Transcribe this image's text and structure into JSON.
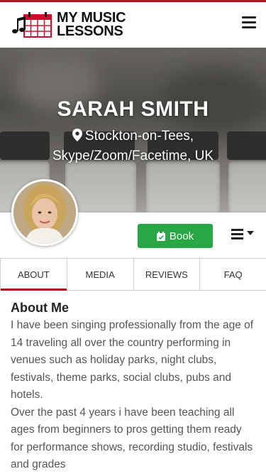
{
  "brand": {
    "name_line1": "MY MUSIC",
    "name_line2": "LESSONS",
    "accent_color": "#b0121b"
  },
  "header": {
    "menu_icon": "hamburger-icon"
  },
  "profile": {
    "name": "SARAH SMITH",
    "location_line1": "Stockton-on-Tees,",
    "location_line2": "Skype/Zoom/Facetime, UK",
    "location_icon": "map-pin-icon"
  },
  "actions": {
    "book_label": "Book",
    "book_icon": "calendar-check-icon",
    "book_color": "#28a745",
    "more_icon": "hamburger-dropdown-icon"
  },
  "tabs": [
    {
      "label": "ABOUT",
      "active": true
    },
    {
      "label": "MEDIA",
      "active": false
    },
    {
      "label": "REVIEWS",
      "active": false
    },
    {
      "label": "FAQ",
      "active": false
    }
  ],
  "about": {
    "heading": "About Me",
    "paragraph1": "I have been singing professionally from the age of 14 traveling all over the country performing in venues such as holiday parks, night clubs, festivals, theme parks, social clubs, pubs and hotels.",
    "paragraph2": "Over the past 4 years i have been teaching all ages from beginners to pros getting them ready for performance shows, recording studio, festivals and grades"
  }
}
